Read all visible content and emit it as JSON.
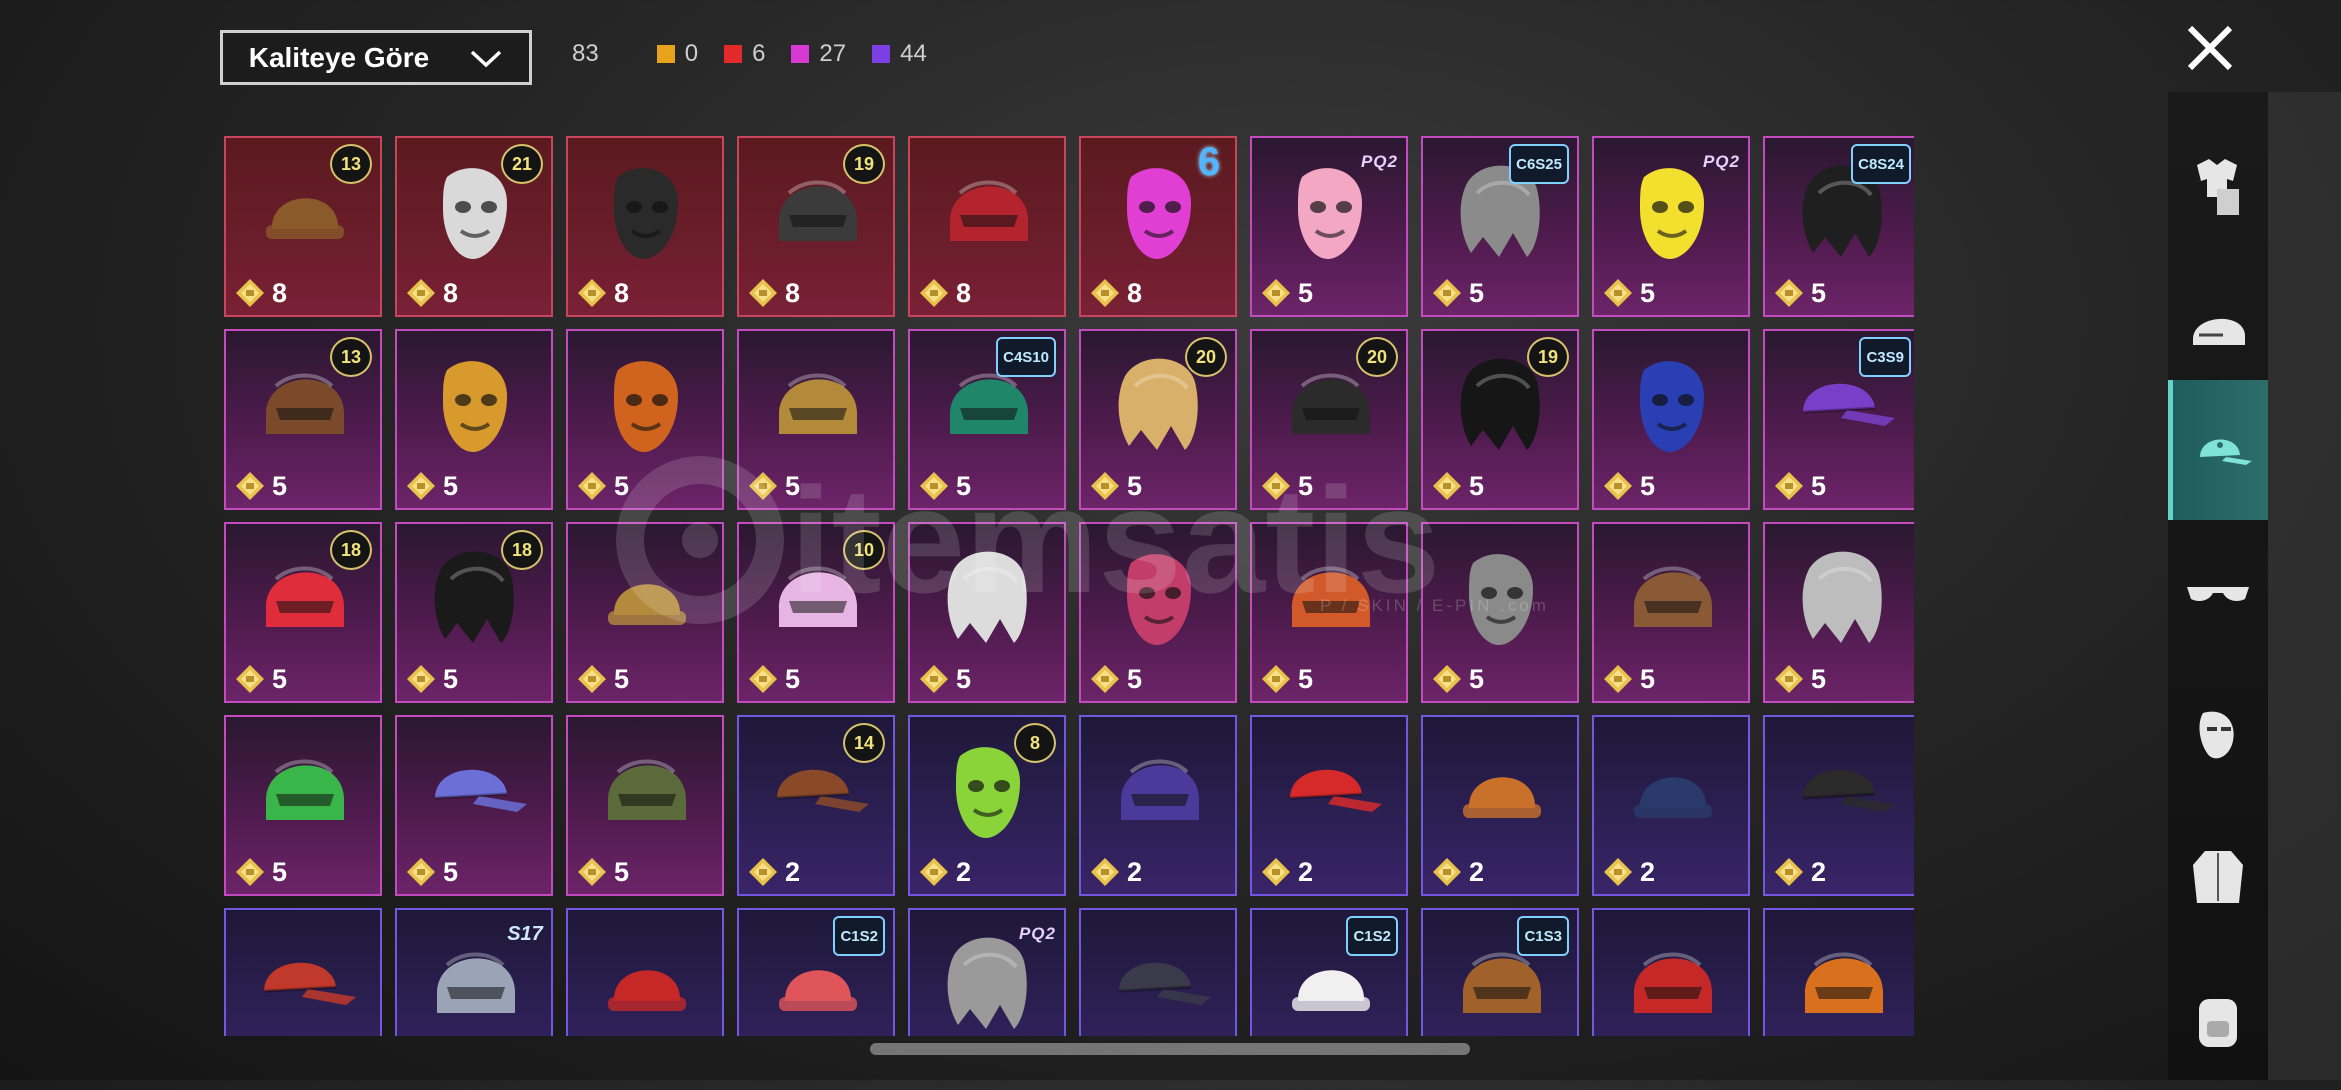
{
  "header": {
    "sort_label": "Kaliteye Göre",
    "total_count": "83",
    "stats": [
      {
        "color": "#e8a21c",
        "value": "0"
      },
      {
        "color": "#e32a2a",
        "value": "6"
      },
      {
        "color": "#d63ad3",
        "value": "27"
      },
      {
        "color": "#7b3fe4",
        "value": "44"
      }
    ]
  },
  "watermark": {
    "text": "itemsatis",
    "sub": "P / SKIN / E-PIN .com"
  },
  "sidebar": {
    "tabs": [
      {
        "icon": "outfit-icon",
        "active": false
      },
      {
        "icon": "helmet-icon",
        "active": false
      },
      {
        "icon": "cap-icon",
        "active": true
      },
      {
        "icon": "glasses-icon",
        "active": false
      },
      {
        "icon": "mask-icon",
        "active": false
      },
      {
        "icon": "jacket-icon",
        "active": false
      },
      {
        "icon": "backpack-icon",
        "active": false
      }
    ]
  },
  "items": [
    {
      "rarity": "red",
      "price": "8",
      "badge": "13",
      "badge_type": "hex",
      "icon": "straw-hat-icon",
      "hue": "#8a5a2b"
    },
    {
      "rarity": "red",
      "price": "8",
      "badge": "21",
      "badge_type": "hex",
      "icon": "clown-mask-icon",
      "hue": "#d9d9d9"
    },
    {
      "rarity": "red",
      "price": "8",
      "badge": "",
      "badge_type": "",
      "icon": "oni-mask-icon",
      "hue": "#2a2a2a"
    },
    {
      "rarity": "red",
      "price": "8",
      "badge": "19",
      "badge_type": "hex",
      "icon": "tech-helmet-icon",
      "hue": "#3b3b3b"
    },
    {
      "rarity": "red",
      "price": "8",
      "badge": "",
      "badge_type": "",
      "icon": "red-helmet-icon",
      "hue": "#b3242f"
    },
    {
      "rarity": "red",
      "price": "8",
      "badge": "6",
      "badge_type": "big",
      "icon": "box-head-icon",
      "hue": "#e13fd4"
    },
    {
      "rarity": "pink",
      "price": "5",
      "badge": "PQ2",
      "badge_type": "tag",
      "icon": "bow-headband-icon",
      "hue": "#f4a7c3"
    },
    {
      "rarity": "pink",
      "price": "5",
      "badge": "C6S25",
      "badge_type": "season",
      "icon": "silver-hair-icon",
      "hue": "#8b8b8b"
    },
    {
      "rarity": "pink",
      "price": "5",
      "badge": "PQ2",
      "badge_type": "tag",
      "icon": "yellow-box-icon",
      "hue": "#f3df2d"
    },
    {
      "rarity": "pink",
      "price": "5",
      "badge": "C8S24",
      "badge_type": "season",
      "icon": "black-hair-icon",
      "hue": "#1f1f1f"
    },
    {
      "rarity": "pink",
      "price": "5",
      "badge": "13",
      "badge_type": "hex",
      "icon": "goggles-icon",
      "hue": "#7a4a2a"
    },
    {
      "rarity": "pink",
      "price": "5",
      "badge": "",
      "badge_type": "",
      "icon": "potato-head-icon",
      "hue": "#d99a2d"
    },
    {
      "rarity": "pink",
      "price": "5",
      "badge": "",
      "badge_type": "",
      "icon": "dragon-mask-icon",
      "hue": "#d0641e"
    },
    {
      "rarity": "pink",
      "price": "5",
      "badge": "",
      "badge_type": "",
      "icon": "gold-helmet-icon",
      "hue": "#b28a3a"
    },
    {
      "rarity": "pink",
      "price": "5",
      "badge": "C4S10",
      "badge_type": "season",
      "icon": "green-helmet-icon",
      "hue": "#20866a"
    },
    {
      "rarity": "pink",
      "price": "5",
      "badge": "20",
      "badge_type": "hex",
      "icon": "bunny-wig-icon",
      "hue": "#d8b06a"
    },
    {
      "rarity": "pink",
      "price": "5",
      "badge": "20",
      "badge_type": "hex",
      "icon": "black-gold-helmet-icon",
      "hue": "#2b2b2b"
    },
    {
      "rarity": "pink",
      "price": "5",
      "badge": "19",
      "badge_type": "hex",
      "icon": "bun-hair-icon",
      "hue": "#161616"
    },
    {
      "rarity": "pink",
      "price": "5",
      "badge": "",
      "badge_type": "",
      "icon": "wolf-mask-icon",
      "hue": "#2a3fb3"
    },
    {
      "rarity": "pink",
      "price": "5",
      "badge": "C3S9",
      "badge_type": "season",
      "icon": "purple-cap-icon",
      "hue": "#7a3fc9"
    },
    {
      "rarity": "pink",
      "price": "5",
      "badge": "18",
      "badge_type": "hex",
      "icon": "uncle-sam-hat-icon",
      "hue": "#e02d3c"
    },
    {
      "rarity": "pink",
      "price": "5",
      "badge": "18",
      "badge_type": "hex",
      "icon": "dark-hair-icon",
      "hue": "#1a1a1a"
    },
    {
      "rarity": "pink",
      "price": "5",
      "badge": "",
      "badge_type": "",
      "icon": "straw-boater-icon",
      "hue": "#b48b3c"
    },
    {
      "rarity": "pink",
      "price": "5",
      "badge": "10",
      "badge_type": "hex",
      "icon": "pink-helmet-icon",
      "hue": "#e6b5e3"
    },
    {
      "rarity": "pink",
      "price": "5",
      "badge": "",
      "badge_type": "",
      "icon": "white-hair-icon",
      "hue": "#dcdcdc"
    },
    {
      "rarity": "pink",
      "price": "5",
      "badge": "",
      "badge_type": "",
      "icon": "feather-headdress-icon",
      "hue": "#c23d6a"
    },
    {
      "rarity": "pink",
      "price": "5",
      "badge": "",
      "badge_type": "",
      "icon": "bandana-icon",
      "hue": "#d25a2a"
    },
    {
      "rarity": "pink",
      "price": "5",
      "badge": "",
      "badge_type": "",
      "icon": "grey-wolf-icon",
      "hue": "#8a8a8a"
    },
    {
      "rarity": "pink",
      "price": "5",
      "badge": "",
      "badge_type": "",
      "icon": "copper-helmet-icon",
      "hue": "#8a5a36"
    },
    {
      "rarity": "pink",
      "price": "5",
      "badge": "",
      "badge_type": "",
      "icon": "skull-hair-icon",
      "hue": "#bdbdbd"
    },
    {
      "rarity": "pink",
      "price": "5",
      "badge": "",
      "badge_type": "",
      "icon": "frog-hat-icon",
      "hue": "#3ab54a"
    },
    {
      "rarity": "pink",
      "price": "5",
      "badge": "",
      "badge_type": "",
      "icon": "holo-cap-icon",
      "hue": "#6b6fd6"
    },
    {
      "rarity": "pink",
      "price": "5",
      "badge": "",
      "badge_type": "",
      "icon": "army-helmet-icon",
      "hue": "#5a6a3a"
    },
    {
      "rarity": "purple",
      "price": "2",
      "badge": "14",
      "badge_type": "hex",
      "icon": "long-hair-cap-icon",
      "hue": "#8a4a2a"
    },
    {
      "rarity": "purple",
      "price": "2",
      "badge": "8",
      "badge_type": "hex",
      "icon": "green-skull-icon",
      "hue": "#8ad43a"
    },
    {
      "rarity": "purple",
      "price": "2",
      "badge": "",
      "badge_type": "",
      "icon": "purple-robot-icon",
      "hue": "#4a3a9a"
    },
    {
      "rarity": "purple",
      "price": "2",
      "badge": "",
      "badge_type": "",
      "icon": "red-cap-icon",
      "hue": "#d62a2a"
    },
    {
      "rarity": "purple",
      "price": "2",
      "badge": "",
      "badge_type": "",
      "icon": "orange-beanie-icon",
      "hue": "#c9702a"
    },
    {
      "rarity": "purple",
      "price": "2",
      "badge": "",
      "badge_type": "",
      "icon": "navy-beanie-icon",
      "hue": "#2a3a6a"
    },
    {
      "rarity": "purple",
      "price": "2",
      "badge": "",
      "badge_type": "",
      "icon": "black-snapback-icon",
      "hue": "#2a2a2a"
    },
    {
      "rarity": "purple",
      "price": "",
      "badge": "",
      "badge_type": "",
      "icon": "red-gold-cap-icon",
      "hue": "#c0392b"
    },
    {
      "rarity": "purple",
      "price": "",
      "badge": "S17",
      "badge_type": "s17",
      "icon": "knight-helmet-icon",
      "hue": "#9aa4b6"
    },
    {
      "rarity": "purple",
      "price": "",
      "badge": "",
      "badge_type": "",
      "icon": "fez-icon",
      "hue": "#c62828"
    },
    {
      "rarity": "purple",
      "price": "",
      "badge": "C1S2",
      "badge_type": "season",
      "icon": "striped-beanie-icon",
      "hue": "#e0555a"
    },
    {
      "rarity": "purple",
      "price": "",
      "badge": "PQ2",
      "badge_type": "tag",
      "icon": "grey-hair-icon",
      "hue": "#9a9a9a"
    },
    {
      "rarity": "purple",
      "price": "",
      "badge": "",
      "badge_type": "",
      "icon": "headset-cap-icon",
      "hue": "#3a3a4a"
    },
    {
      "rarity": "purple",
      "price": "",
      "badge": "C1S2",
      "badge_type": "season",
      "icon": "chef-hat-icon",
      "hue": "#f0f0f0"
    },
    {
      "rarity": "purple",
      "price": "",
      "badge": "C1S3",
      "badge_type": "season",
      "icon": "bronze-mech-icon",
      "hue": "#a0612a"
    },
    {
      "rarity": "purple",
      "price": "",
      "badge": "",
      "badge_type": "",
      "icon": "football-helmet-icon",
      "hue": "#c62828"
    },
    {
      "rarity": "purple",
      "price": "",
      "badge": "",
      "badge_type": "",
      "icon": "flame-helmet-icon",
      "hue": "#d9701e"
    }
  ]
}
